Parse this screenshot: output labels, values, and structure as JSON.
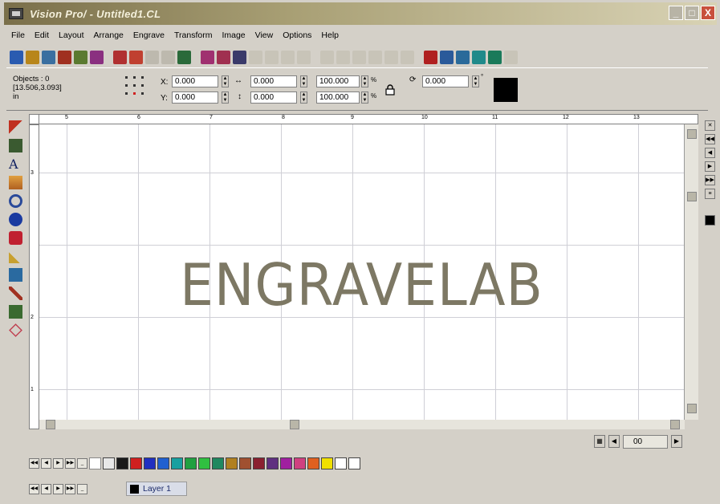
{
  "window": {
    "title": "Vision Pro/ - Untitled1.CL",
    "controls": {
      "minimize": "_",
      "maximize": "□",
      "close": "X"
    }
  },
  "menu": [
    "File",
    "Edit",
    "Layout",
    "Arrange",
    "Engrave",
    "Transform",
    "Image",
    "View",
    "Options",
    "Help"
  ],
  "properties": {
    "objects_label": "Objects : 0",
    "coords": "[13.506,3.093]",
    "unit": "in",
    "x_label": "X:",
    "y_label": "Y:",
    "x_value": "0.000",
    "y_value": "0.000",
    "width_value": "0.000",
    "height_value": "0.000",
    "scale_w": "100.000",
    "scale_h": "100.000",
    "rotation_value": "0.000",
    "scale_unit": "%",
    "degree_unit": "°"
  },
  "ruler": {
    "top_labels": [
      "5",
      "6",
      "7",
      "8",
      "9",
      "10",
      "11",
      "12",
      "13"
    ],
    "left_labels": [
      "3",
      "2",
      "1"
    ]
  },
  "canvas": {
    "text": "ENGRAVELAB"
  },
  "page_nav": {
    "value": "00"
  },
  "palette": {
    "colors": [
      "#1a1a1a",
      "#d02020",
      "#2030c0",
      "#2060d0",
      "#18a0a0",
      "#20a040",
      "#30c040",
      "#208860",
      "#b08020",
      "#a05030",
      "#8a2030",
      "#603080",
      "#a020a0",
      "#d04080",
      "#e06020",
      "#f0e000"
    ]
  },
  "layer": {
    "name": "Layer 1",
    "color": "#000000"
  }
}
